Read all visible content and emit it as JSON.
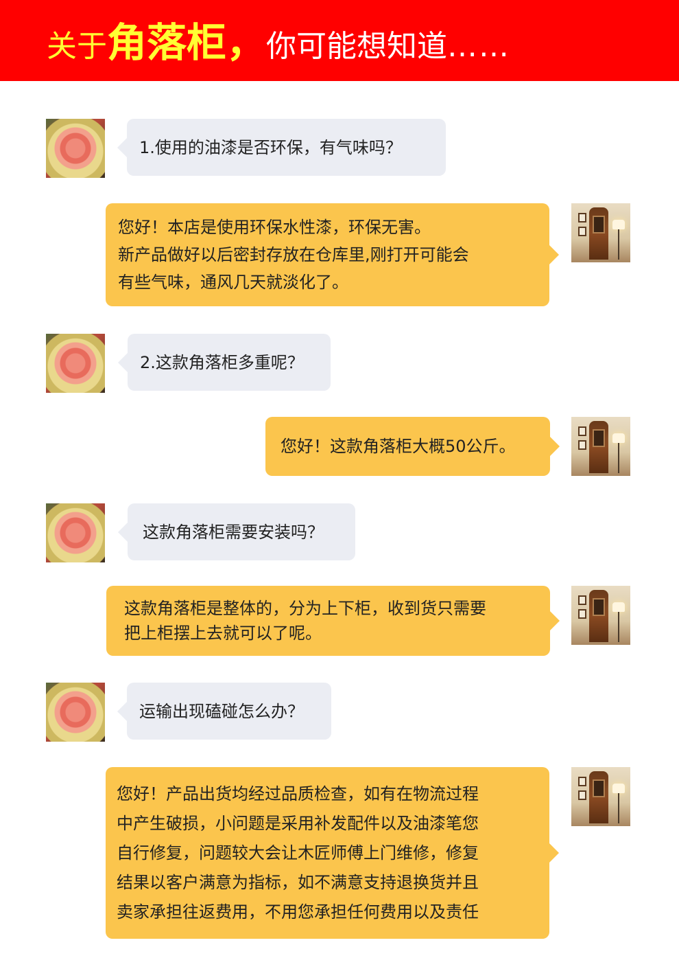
{
  "banner": {
    "prefix": "关于",
    "highlight": "角落柜",
    "comma": "，",
    "suffix": "你可能想知道",
    "dots": "……"
  },
  "conversation": [
    {
      "role": "customer",
      "text": "1.使用的油漆是否环保，有气味吗？"
    },
    {
      "role": "seller",
      "text": "您好！本店是使用环保水性漆，环保无害。\n新产品做好以后密封存放在仓库里,刚打开可能会\n有些气味，通风几天就淡化了。"
    },
    {
      "role": "customer",
      "text": "2.这款角落柜多重呢？"
    },
    {
      "role": "seller",
      "text": "您好！这款角落柜大概50公斤。"
    },
    {
      "role": "customer",
      "text": "这款角落柜需要安装吗？"
    },
    {
      "role": "seller",
      "text": "这款角落柜是整体的，分为上下柜，收到货只需要\n把上柜摆上去就可以了呢。"
    },
    {
      "role": "customer",
      "text": "运输出现磕碰怎么办？"
    },
    {
      "role": "seller",
      "text": "您好！产品出货均经过品质检查，如有在物流过程\n中产生破损，小问题是采用补发配件以及油漆笔您\n自行修复，问题较大会让木匠师傅上门维修，修复\n结果以客户满意为指标，如不满意支持退换货并且\n卖家承担往返费用，不用您承担任何费用以及责任"
    }
  ],
  "avatars": {
    "customer": "fruit-carving-avatar",
    "seller": "corner-cabinet-avatar"
  },
  "colors": {
    "banner_bg": "#ff0000",
    "banner_highlight": "#ffff33",
    "question_bubble": "#ebedf3",
    "answer_bubble": "#fbc54d"
  }
}
